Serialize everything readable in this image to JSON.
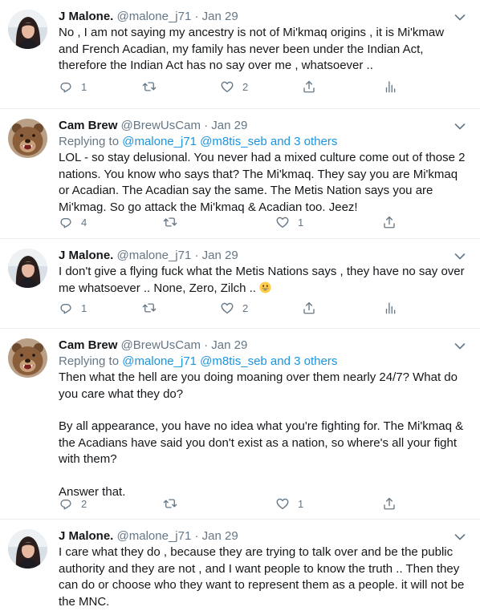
{
  "tweets": [
    {
      "name": "J Malone.",
      "handle": "@malone_j71",
      "dot": "·",
      "date": "Jan 29",
      "text": "No , I am not saying my ancestry is not of Mi'kmaq origins , it is Mi'kmaw and French Acadian, my family has never been under the Indian Act, therefore the Indian Act has no say over me , whatsoever ..",
      "reply_count": "1",
      "retweet_count": "",
      "like_count": "2"
    },
    {
      "name": "Cam Brew",
      "handle": "@BrewUsCam",
      "dot": "·",
      "date": "Jan 29",
      "replying_prefix": "Replying to",
      "replying_to": "@malone_j71 @m8tis_seb and 3 others",
      "text": "LOL - so stay delusional. You never had a mixed culture come out of those 2 nations. You know who says that? The Mi'kmaq. They say you are Mi'kmaq or Acadian. The Acadian say the same. The Metis Nation says you are Mi'kmag. So go attack the Mi'kmaq & Acadian too. Jeez!",
      "reply_count": "4",
      "retweet_count": "",
      "like_count": "1"
    },
    {
      "name": "J Malone.",
      "handle": "@malone_j71",
      "dot": "·",
      "date": "Jan 29",
      "text": "I don't give a flying fuck what the Metis Nations says , they have no say over me whatsoever .. None, Zero, Zilch ..",
      "emoji": "grinning-face-emoji",
      "reply_count": "1",
      "retweet_count": "",
      "like_count": "2"
    },
    {
      "name": "Cam Brew",
      "handle": "@BrewUsCam",
      "dot": "·",
      "date": "Jan 29",
      "replying_prefix": "Replying to",
      "replying_to": "@malone_j71 @m8tis_seb and 3 others",
      "paragraphs": [
        "Then what the hell are you doing moaning over them nearly 24/7? What do you care what they do?",
        "By all appearance, you have no idea what you're fighting for. The Mi'kmaq & the Acadians have said you don't exist as a nation, so where's all your fight with them?",
        "Answer that."
      ],
      "reply_count": "2",
      "retweet_count": "",
      "like_count": "1"
    },
    {
      "name": "J Malone.",
      "handle": "@malone_j71",
      "dot": "·",
      "date": "Jan 29",
      "text": "I care what they do , because they are trying to talk over and be the public authority and they are not , and I want people to know the truth .. Then they can do or choose who they want to represent them as a people. it will not be the MNC."
    }
  ],
  "icons": {
    "reply": "reply-icon",
    "retweet": "retweet-icon",
    "like": "heart-icon",
    "share": "share-icon",
    "analytics": "analytics-icon",
    "more": "chevron-down-icon"
  },
  "colors": {
    "text": "#14171a",
    "secondary": "#657786",
    "link": "#1b95e0",
    "divider": "#e6ecf0"
  }
}
